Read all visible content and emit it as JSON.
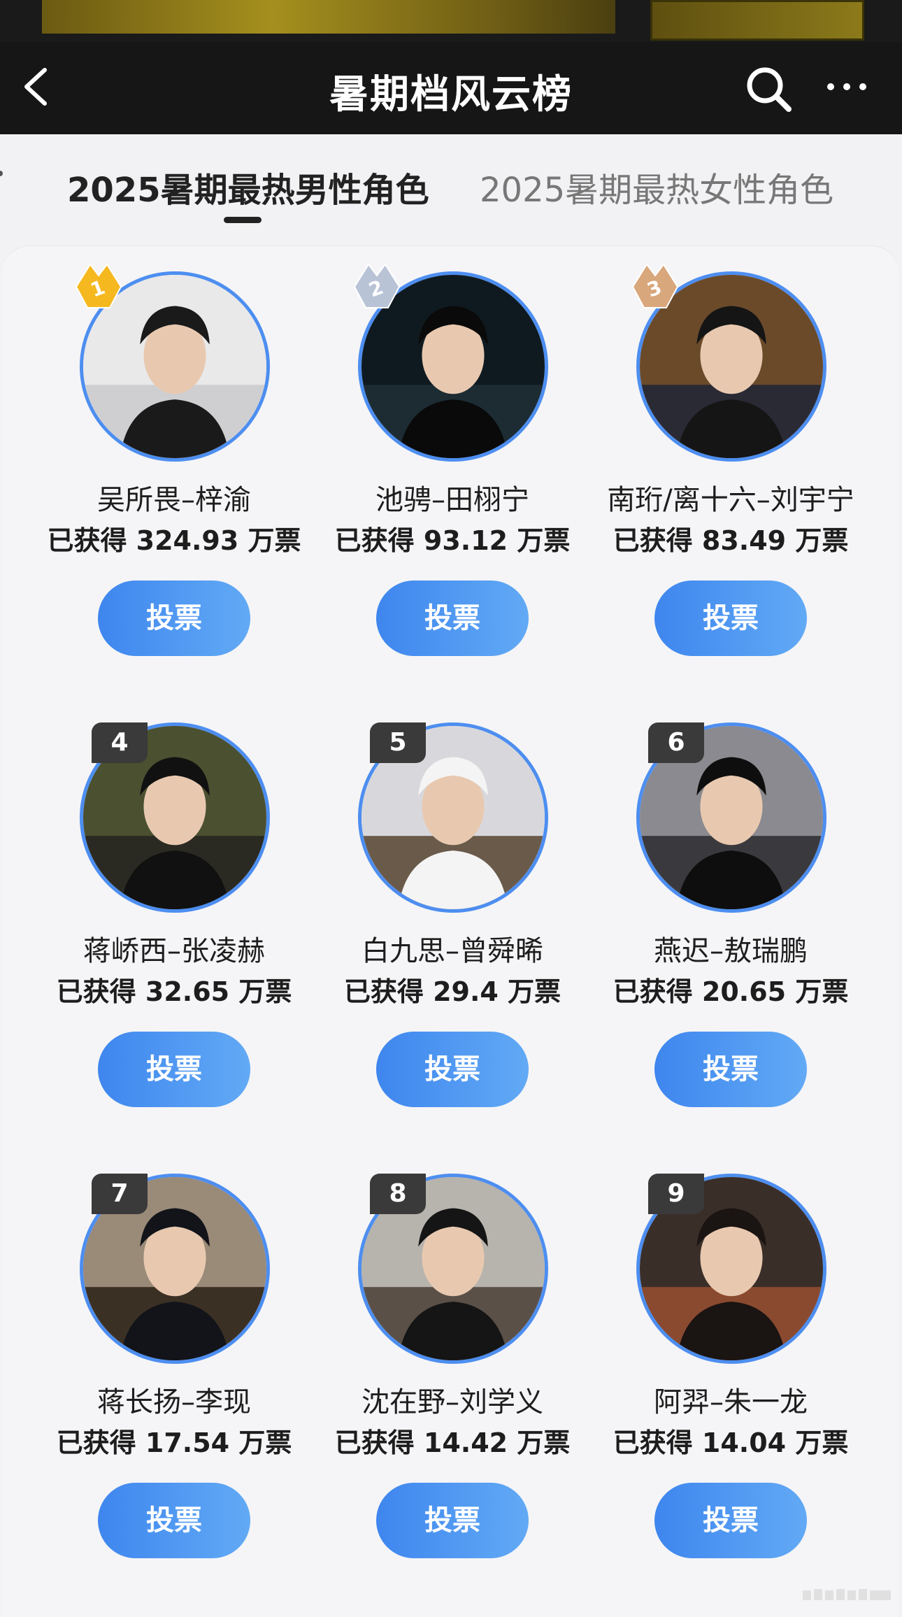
{
  "header": {
    "title": "暑期档风云榜",
    "back_icon": "chevron-left-icon",
    "search_icon": "search-icon",
    "more_icon": "more-dots-icon"
  },
  "tabs": [
    {
      "label": "2025暑期最热男性角色",
      "active": true
    },
    {
      "label": "2025暑期最热女性角色",
      "active": false
    }
  ],
  "vote_prefix": "已获得",
  "vote_suffix": "万票",
  "candidates": [
    {
      "rank": "1",
      "name": "吴所畏–梓渝",
      "votes": "324.93",
      "votes_text": "已获得 324.93 万票",
      "button": "投票",
      "medal": "gold"
    },
    {
      "rank": "2",
      "name": "池骋–田栩宁",
      "votes": "93.12",
      "votes_text": "已获得 93.12 万票",
      "button": "投票",
      "medal": "silver"
    },
    {
      "rank": "3",
      "name": "南珩/离十六–刘宇宁",
      "votes": "83.49",
      "votes_text": "已获得 83.49 万票",
      "button": "投票",
      "medal": "bronze"
    },
    {
      "rank": "4",
      "name": "蒋峤西–张凌赫",
      "votes": "32.65",
      "votes_text": "已获得 32.65 万票",
      "button": "投票"
    },
    {
      "rank": "5",
      "name": "白九思–曾舜晞",
      "votes": "29.4",
      "votes_text": "已获得 29.4 万票",
      "button": "投票"
    },
    {
      "rank": "6",
      "name": "燕迟–敖瑞鹏",
      "votes": "20.65",
      "votes_text": "已获得 20.65 万票",
      "button": "投票"
    },
    {
      "rank": "7",
      "name": "蒋长扬–李现",
      "votes": "17.54",
      "votes_text": "已获得 17.54 万票",
      "button": "投票"
    },
    {
      "rank": "8",
      "name": "沈在野–刘学义",
      "votes": "14.42",
      "votes_text": "已获得 14.42 万票",
      "button": "投票"
    },
    {
      "rank": "9",
      "name": "阿羿–朱一龙",
      "votes": "14.04",
      "votes_text": "已获得 14.04 万票",
      "button": "投票"
    }
  ],
  "colors": {
    "accent": "#4d8ef0",
    "button_start": "#3e86ee",
    "button_end": "#62aaf5",
    "nav_bg": "#161616",
    "gold": "#f5b81f",
    "silver": "#b9c3d6",
    "bronze": "#d9a77c"
  }
}
